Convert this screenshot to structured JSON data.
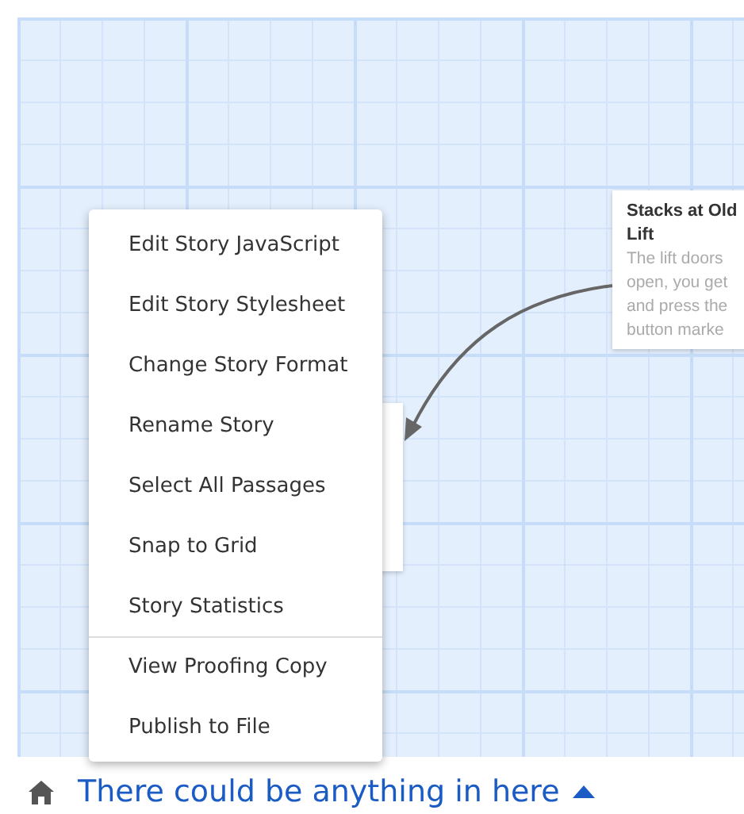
{
  "story_map": {
    "passages": [
      {
        "title": "Stacks at Old Lift",
        "excerpt": "The lift doors open, you get and press the button marke"
      }
    ]
  },
  "context_menu": {
    "sections": [
      [
        "Edit Story JavaScript",
        "Edit Story Stylesheet",
        "Change Story Format",
        "Rename Story",
        "Select All Passages",
        "Snap to Grid",
        "Story Statistics"
      ],
      [
        "View Proofing Copy",
        "Publish to File"
      ]
    ]
  },
  "footer": {
    "story_name": "There could be anything in here"
  }
}
